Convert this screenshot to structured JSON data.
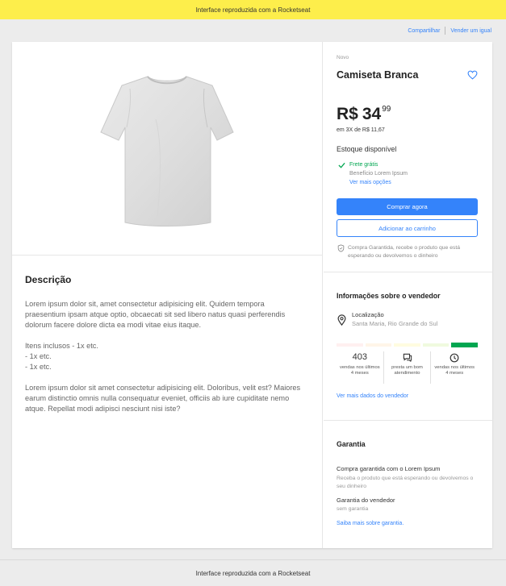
{
  "topbar": {
    "text": "Interface reproduzida com a Rocketseat"
  },
  "toplinks": {
    "share": "Compartilhar",
    "sell": "Vender um igual"
  },
  "product": {
    "condition": "Novo",
    "title": "Camiseta Branca",
    "price_currency": "R$",
    "price_integer": "34",
    "price_cents": "99",
    "installments": "em 3X de R$ 11,67",
    "stock": "Estoque disponível",
    "shipping_free": "Frete grátis",
    "benefit": "Benefício Lorem Ipsum",
    "more_options": "Ver mais opções",
    "buy_now": "Comprar agora",
    "add_to_cart": "Adicionar ao carrinho",
    "guarantee_note": "Compra Garantida, recebe o produto que está esperando ou devolvemos o dinheiro"
  },
  "description": {
    "title": "Descrição",
    "paragraphs": [
      "Lorem ipsum dolor sit, amet consectetur adipisicing elit. Quidem tempora praesentium ipsam atque optio, obcaecati sit sed libero natus quasi perferendis dolorum facere dolore dicta ea modi vitae eius itaque.",
      "Itens inclusos - 1x etc.\n- 1x etc.\n- 1x etc.",
      "Lorem ipsum dolor sit amet consectetur adipisicing elit. Doloribus, velit est? Maiores earum distinctio omnis nulla consequatur eveniet, officiis ab iure cupiditate nemo atque. Repellat modi adipisci nesciunt nisi iste?"
    ]
  },
  "seller": {
    "title": "Informações sobre o vendedor",
    "location_label": "Localização",
    "location_value": "Santa Maria, Rio Grande do Sul",
    "reputation_colors": [
      "#fff0f0",
      "#fff5e8",
      "#fffce0",
      "#f0fadf",
      "#00a650"
    ],
    "stats": [
      {
        "value": "403",
        "label": "vendas nos últimos 4 meses"
      },
      {
        "icon": "chat-icon",
        "label": "presta um bom atendimento"
      },
      {
        "icon": "clock-icon",
        "label": "vendas nos últimos 4 meses"
      }
    ],
    "more": "Ver mais dados do vendedor"
  },
  "warranty": {
    "title": "Garantia",
    "item1_title": "Compra garantida com o Lorem Ipsum",
    "item1_desc": "Receba o produto que está esperando ou devolvemos o seu dinheiro",
    "item2_title": "Garantia do vendedor",
    "item2_desc": "sem garantia",
    "more": "Saiba mais sobre garantia."
  },
  "footer": {
    "text": "Interface reproduzida com a Rocketseat"
  },
  "colors": {
    "accent": "#3483fa",
    "topbar": "#fdee4b",
    "success": "#00a650"
  }
}
